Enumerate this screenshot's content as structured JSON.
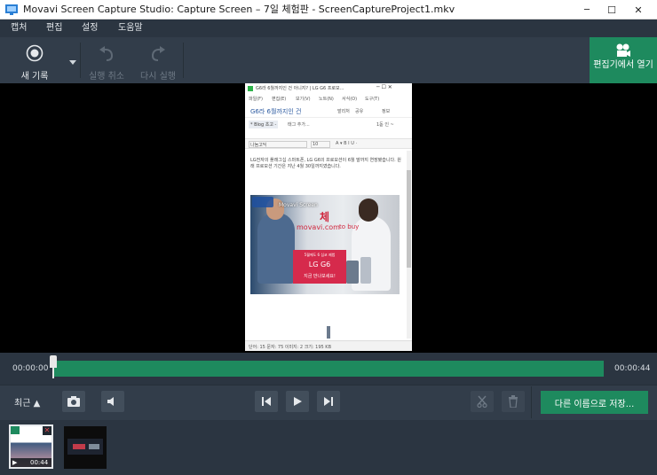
{
  "window": {
    "title": "Movavi Screen Capture Studio: Capture Screen – 7일 체험판 - ScreenCaptureProject1.mkv",
    "minimize": "─",
    "maximize": "☐",
    "close": "✕"
  },
  "menu": {
    "items": [
      "캡처",
      "편집",
      "설정",
      "도움말"
    ]
  },
  "toolbar": {
    "record_label": "새 기록",
    "undo_label": "실행 취소",
    "redo_label": "다시 실행",
    "open_editor_label": "편집기에서 열기"
  },
  "inner_app": {
    "title": "G6라 6월까지인 건 아니지? | LG G6 프로모...",
    "menu": [
      "파일(F)",
      "편집(E)",
      "보기(V)",
      "노트(N)",
      "서식(O)",
      "도구(T)"
    ],
    "post_title": "G6라 6월까지인 건",
    "publish": "발리처",
    "share": "공유",
    "info": "정보",
    "blog_tag": "* Blog 초고 -",
    "tag_add": "태그 추가...",
    "pages": "1돋 인 ~",
    "font": "나눔고딕",
    "font_size": "10",
    "body_text": "LG전자의 플래그십 스마트폰, LG G6의 프로모션이 6월 말까지 연장됐습니다. 원래 프로모션 기간은 지난 4월 30일까지였습니다.",
    "image_watermark_1": "Movavi Screen",
    "image_watermark_2": "체",
    "image_watermark_3": "movavi.com",
    "image_watermark_4": "to buy",
    "promo_line1": "5월에도 6 심코 제법",
    "promo_brand": "LG G6",
    "promo_line2": "지금 만나보세요!",
    "status": "단어: 15   문자: 75   이미지: 2   크기: 195 KB"
  },
  "timeline": {
    "start": "00:00:00",
    "end": "00:00:44",
    "playhead_fraction": 0.0
  },
  "controls": {
    "recent_label": "최근 ▲",
    "save_as_label": "다른 이름으로 저장..."
  },
  "thumbnails": [
    {
      "duration": "00:44",
      "selected": true
    },
    {
      "duration": "",
      "selected": false
    }
  ],
  "colors": {
    "accent": "#1e8a5e",
    "background": "#2b3541",
    "toolbar": "#323d4a"
  }
}
